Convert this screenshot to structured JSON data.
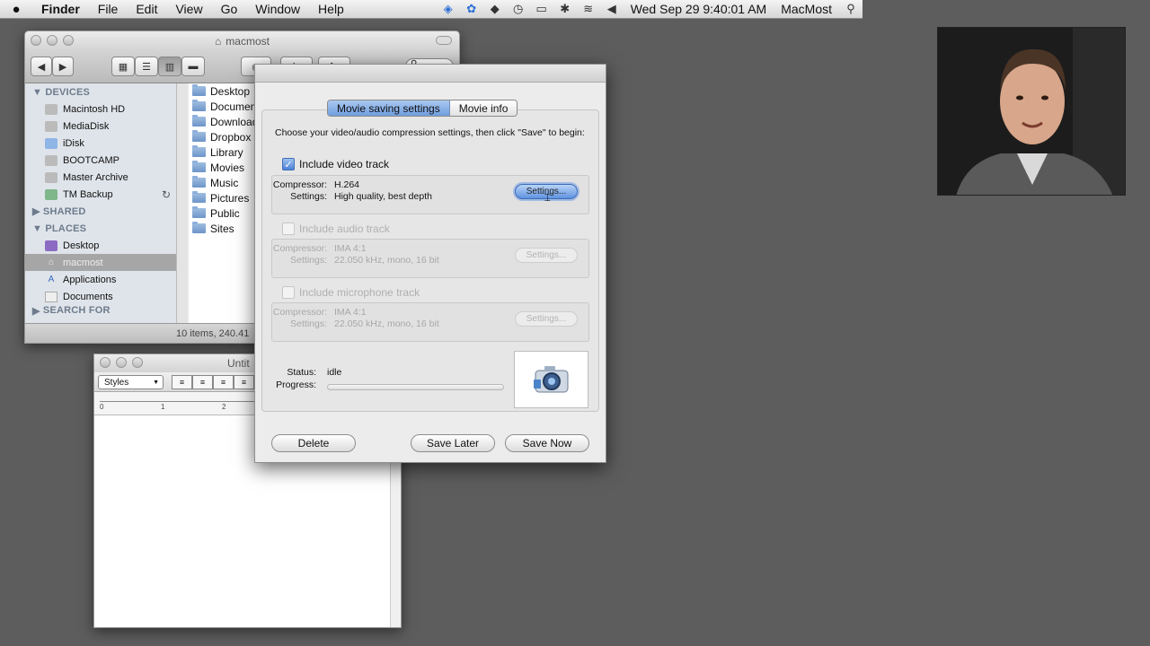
{
  "menubar": {
    "apple": "",
    "items": [
      "Finder",
      "File",
      "Edit",
      "View",
      "Go",
      "Window",
      "Help"
    ],
    "clock": "Wed Sep 29  9:40:01 AM",
    "user": "MacMost"
  },
  "finder": {
    "title": "macmost",
    "sidebar": {
      "devices_label": "DEVICES",
      "devices": [
        "Macintosh HD",
        "MediaDisk",
        "iDisk",
        "BOOTCAMP",
        "Master Archive",
        "TM Backup"
      ],
      "shared_label": "SHARED",
      "places_label": "PLACES",
      "places": [
        "Desktop",
        "macmost",
        "Applications",
        "Documents"
      ],
      "search_label": "SEARCH FOR"
    },
    "folders": [
      "Desktop",
      "Documen",
      "Download",
      "Dropbox",
      "Library",
      "Movies",
      "Music",
      "Pictures",
      "Public",
      "Sites"
    ],
    "status": "10 items, 240.41"
  },
  "textedit": {
    "title": "Untit",
    "styles": "Styles",
    "ruler": [
      "0",
      "1",
      "2"
    ]
  },
  "dialog": {
    "tabs": [
      "Movie saving settings",
      "Movie info"
    ],
    "intro": "Choose your video/audio compression settings, then click \"Save\" to begin:",
    "video": {
      "label": "Include video track",
      "compressor_key": "Compressor:",
      "compressor": "H.264",
      "settings_key": "Settings:",
      "settings": "High quality, best depth",
      "button": "Settings..."
    },
    "audio": {
      "label": "Include audio track",
      "compressor_key": "Compressor:",
      "compressor": "IMA 4:1",
      "settings_key": "Settings:",
      "settings": "22.050 kHz, mono, 16 bit",
      "button": "Settings..."
    },
    "mic": {
      "label": "Include microphone track",
      "compressor_key": "Compressor:",
      "compressor": "IMA 4:1",
      "settings_key": "Settings:",
      "settings": "22.050 kHz, mono, 16 bit",
      "button": "Settings..."
    },
    "status_key": "Status:",
    "status": "idle",
    "progress_key": "Progress:",
    "progress": 0,
    "buttons": {
      "delete": "Delete",
      "save_later": "Save Later",
      "save_now": "Save Now"
    }
  }
}
